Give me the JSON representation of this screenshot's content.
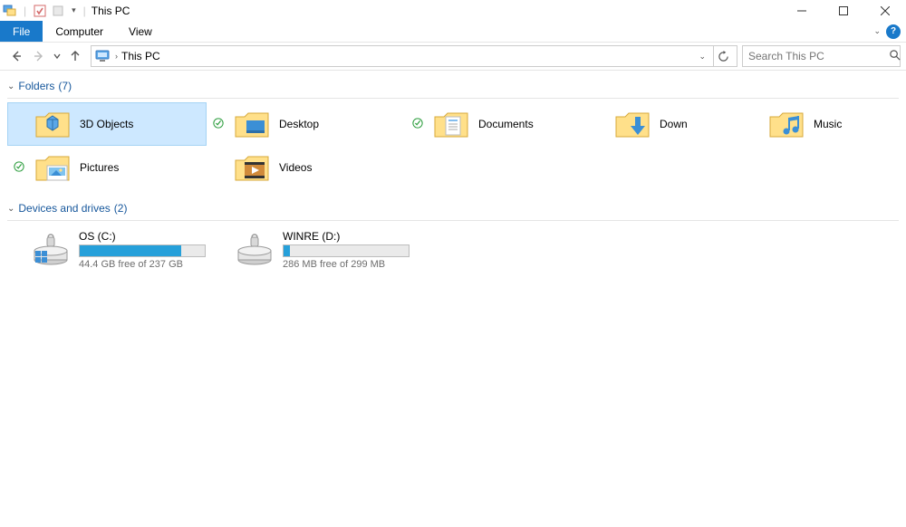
{
  "window": {
    "title": "This PC"
  },
  "ribbon": {
    "file": "File",
    "computer": "Computer",
    "view": "View"
  },
  "nav": {
    "crumb": "This PC",
    "search_placeholder": "Search This PC"
  },
  "groups": {
    "folders": {
      "label": "Folders",
      "count": "(7)"
    },
    "drives": {
      "label": "Devices and drives",
      "count": "(2)"
    }
  },
  "folders": [
    {
      "name": "3D Objects",
      "icon": "3d"
    },
    {
      "name": "Desktop",
      "icon": "desktop"
    },
    {
      "name": "Documents",
      "icon": "documents"
    },
    {
      "name": "Down",
      "icon": "downloads"
    },
    {
      "name": "Music",
      "icon": "music"
    },
    {
      "name": "Pictures",
      "icon": "pictures"
    },
    {
      "name": "Videos",
      "icon": "videos"
    }
  ],
  "drives": [
    {
      "name": "OS (C:)",
      "free_text": "44.4 GB free of 237 GB",
      "fill_percent": 81
    },
    {
      "name": "WINRE (D:)",
      "free_text": "286 MB free of 299 MB",
      "fill_percent": 5
    }
  ]
}
